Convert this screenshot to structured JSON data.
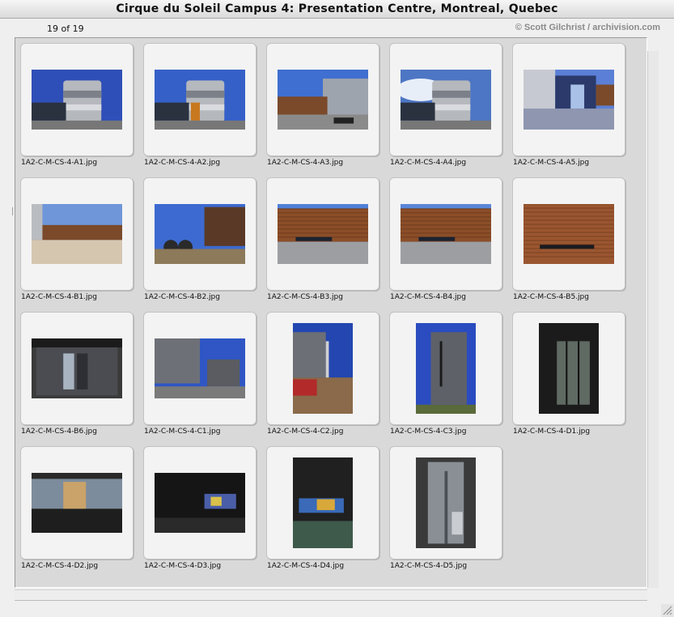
{
  "window": {
    "title": "Cirque du Soleil Campus 4: Presentation Centre, Montreal, Quebec"
  },
  "header": {
    "count": "19 of 19",
    "credit": "© Scott Gilchrist / archivision.com"
  },
  "thumbnails": [
    {
      "label": "1A2-C-M-CS-4-A1.jpg",
      "orientation": "landscape",
      "scene": "cylinder",
      "sky": "#2f4fb8"
    },
    {
      "label": "1A2-C-M-CS-4-A2.jpg",
      "orientation": "landscape",
      "scene": "cylinder-wide",
      "sky": "#3560c8"
    },
    {
      "label": "1A2-C-M-CS-4-A3.jpg",
      "orientation": "landscape",
      "scene": "street",
      "sky": "#3f6fd0"
    },
    {
      "label": "1A2-C-M-CS-4-A4.jpg",
      "orientation": "landscape",
      "scene": "cylinder-cloud",
      "sky": "#4d76c4"
    },
    {
      "label": "1A2-C-M-CS-4-A5.jpg",
      "orientation": "landscape",
      "scene": "entrance",
      "sky": "#5b7fd6"
    },
    {
      "label": "1A2-C-M-CS-4-B1.jpg",
      "orientation": "landscape",
      "scene": "field",
      "sky": "#6f96d8"
    },
    {
      "label": "1A2-C-M-CS-4-B2.jpg",
      "orientation": "landscape",
      "scene": "garden",
      "sky": "#3c6ad0"
    },
    {
      "label": "1A2-C-M-CS-4-B3.jpg",
      "orientation": "landscape",
      "scene": "wood",
      "sky": "#4f80d8"
    },
    {
      "label": "1A2-C-M-CS-4-B4.jpg",
      "orientation": "landscape",
      "scene": "wood2",
      "sky": "#5a86d8"
    },
    {
      "label": "1A2-C-M-CS-4-B5.jpg",
      "orientation": "landscape",
      "scene": "woodclose",
      "sky": "#8a4a22"
    },
    {
      "label": "1A2-C-M-CS-4-B6.jpg",
      "orientation": "landscape",
      "scene": "door",
      "sky": "#3a3a3a"
    },
    {
      "label": "1A2-C-M-CS-4-C1.jpg",
      "orientation": "landscape",
      "scene": "gray",
      "sky": "#2f56c4"
    },
    {
      "label": "1A2-C-M-CS-4-C2.jpg",
      "orientation": "portrait",
      "scene": "portrait-street",
      "sky": "#2346b0"
    },
    {
      "label": "1A2-C-M-CS-4-C3.jpg",
      "orientation": "portrait",
      "scene": "portrait-tower",
      "sky": "#2a4cc0"
    },
    {
      "label": "1A2-C-M-CS-4-D1.jpg",
      "orientation": "portrait",
      "scene": "portrait-dark",
      "sky": "#1b1b1b"
    },
    {
      "label": "1A2-C-M-CS-4-D2.jpg",
      "orientation": "landscape",
      "scene": "interior",
      "sky": "#2a2a2a"
    },
    {
      "label": "1A2-C-M-CS-4-D3.jpg",
      "orientation": "landscape",
      "scene": "interior-dark",
      "sky": "#151515"
    },
    {
      "label": "1A2-C-M-CS-4-D4.jpg",
      "orientation": "portrait",
      "scene": "portrait-interior",
      "sky": "#202020"
    },
    {
      "label": "1A2-C-M-CS-4-D5.jpg",
      "orientation": "portrait",
      "scene": "portrait-steel",
      "sky": "#3a3a3a"
    }
  ]
}
